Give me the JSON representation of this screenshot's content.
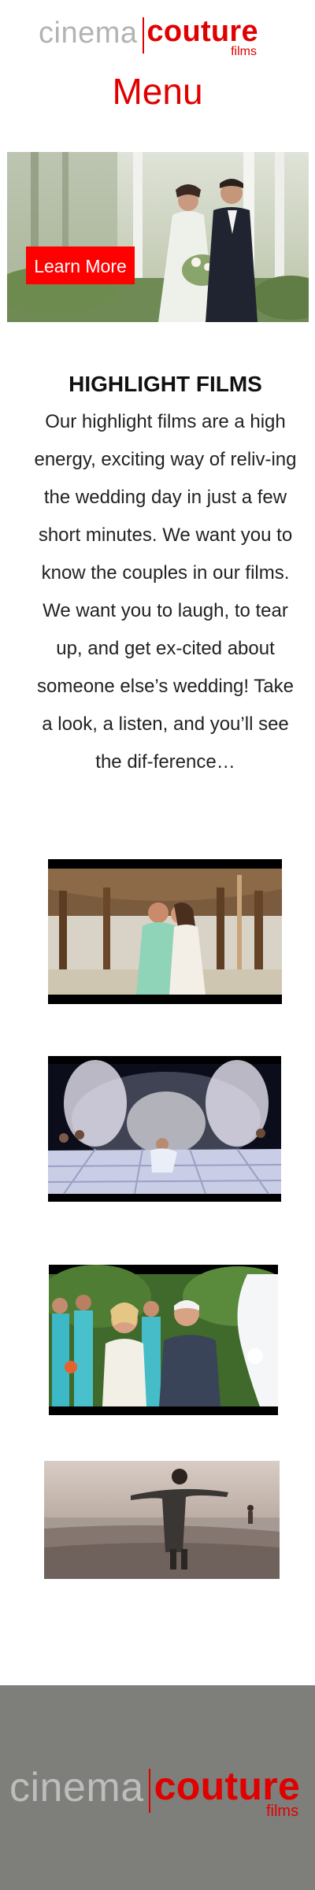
{
  "header": {
    "logo": {
      "word1": "cinema",
      "word2": "couture",
      "word3": "films"
    },
    "menu_label": "Menu"
  },
  "hero": {
    "button_label": "Learn More"
  },
  "highlight": {
    "title": "HIGHLIGHT FILMS",
    "body": "Our highlight films are a high energy, exciting way of reliv-ing the wedding day in just a few short minutes. We want you to know the couples in our films. We want you to laugh, to tear up, and get ex-cited about someone else’s wedding! Take a look, a listen, and you’ll see the dif-ference…"
  },
  "videos": [
    {
      "name": "beach-kiss-video"
    },
    {
      "name": "sparkler-dance-video"
    },
    {
      "name": "ceremony-video"
    },
    {
      "name": "beach-sunset-video"
    }
  ],
  "footer": {
    "logo": {
      "word1": "cinema",
      "word2": "couture",
      "word3": "films"
    }
  },
  "colors": {
    "brand_red": "#e10000",
    "button_red": "#ff0000",
    "logo_grey": "#b3b3b3",
    "footer_bg": "#7e7e7b"
  }
}
